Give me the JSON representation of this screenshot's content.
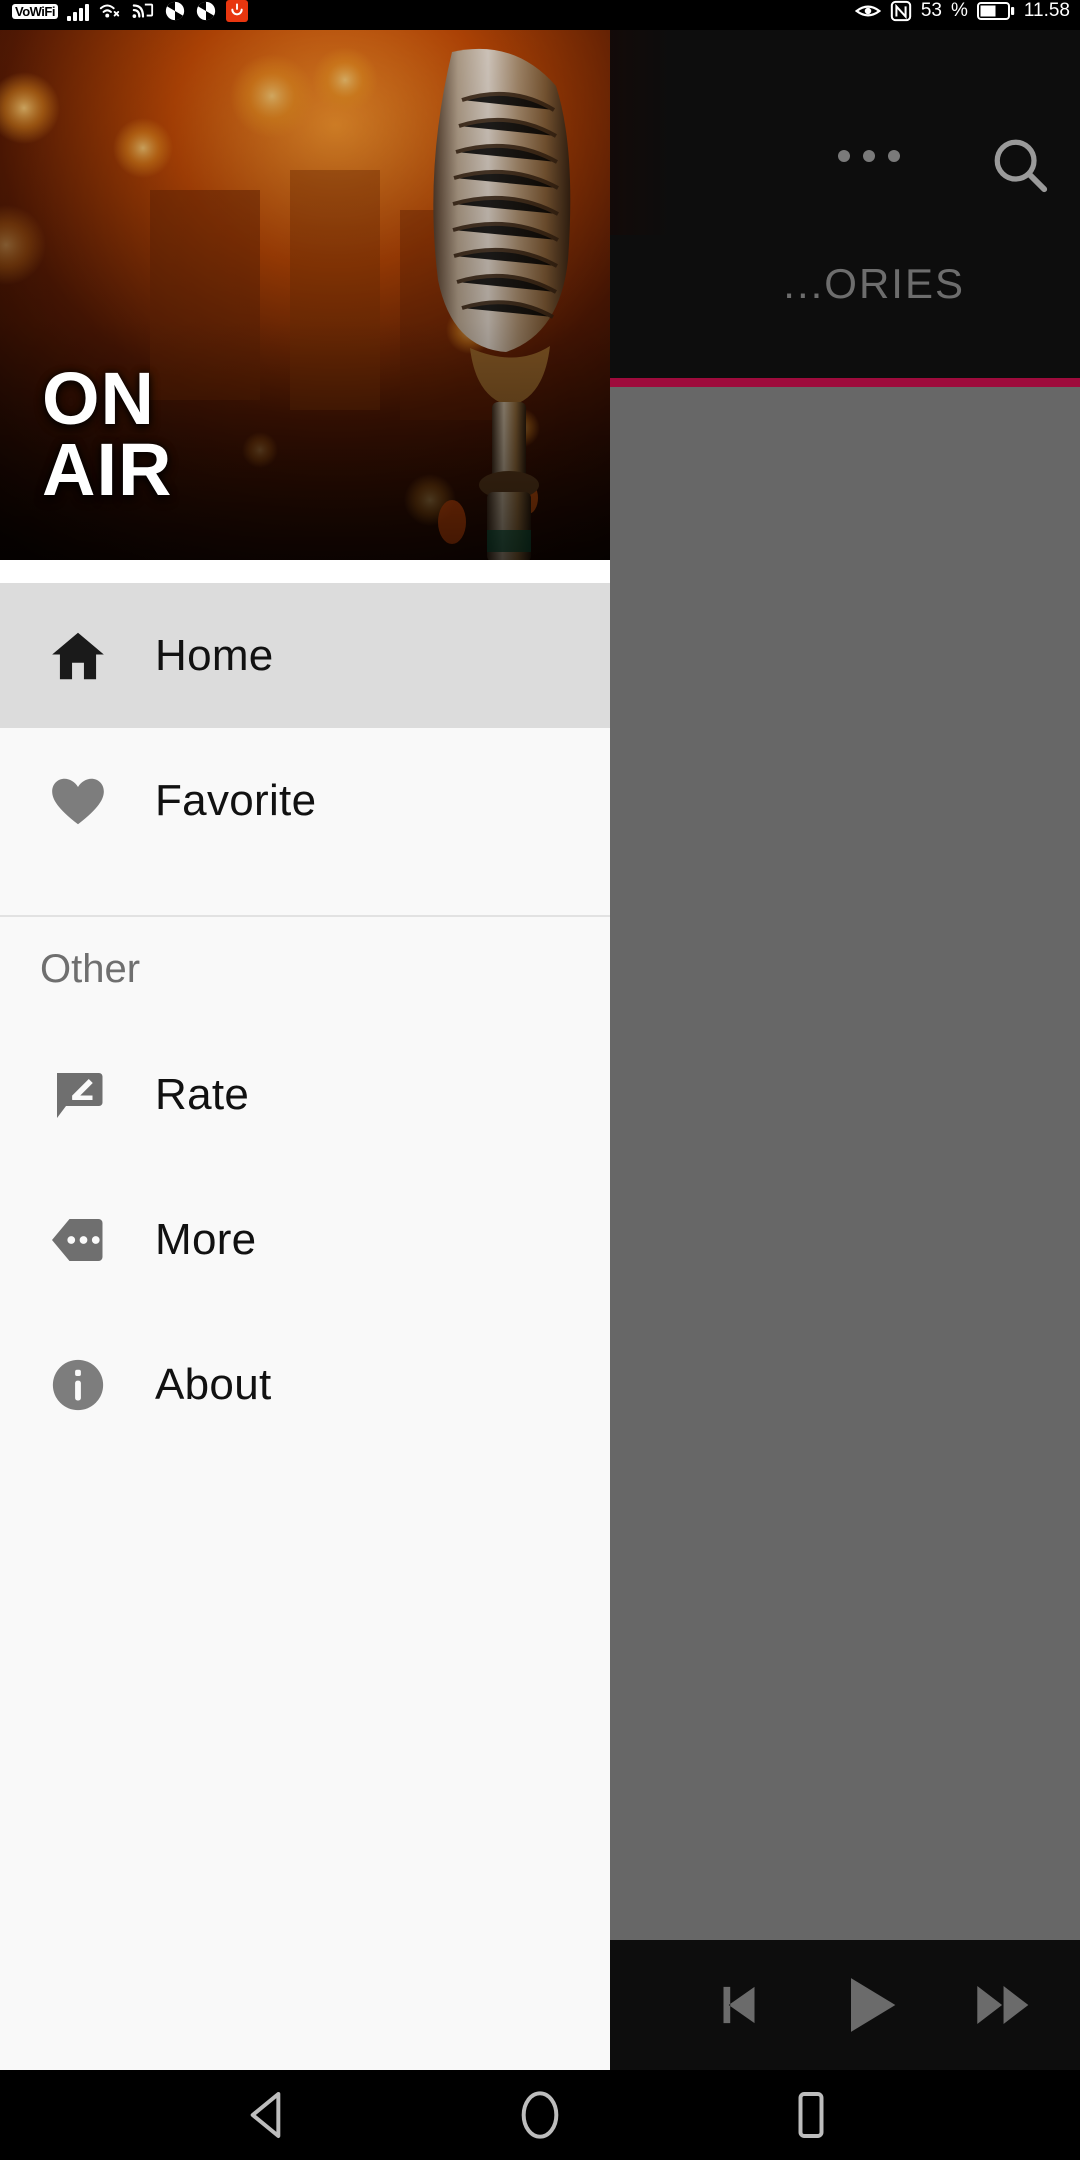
{
  "status_bar": {
    "vowifi_label": "VoWiFi",
    "icons": [
      "signal-bars-icon",
      "wifi-calling-icon",
      "cast-icon",
      "dnd-icon-1",
      "dnd-icon-2",
      "app-alert-icon"
    ],
    "right_icons": [
      "eye-icon",
      "nfc-icon"
    ],
    "battery_percent": "53",
    "percent_symbol": "%",
    "time": "11.58"
  },
  "background_app": {
    "overflow_menu": "overflow-menu",
    "search": "search-icon",
    "tab_label": "...ORIES",
    "accent_color": "#9e0b3c",
    "player": {
      "previous_label": "previous",
      "play_label": "play",
      "forward_label": "fast-forward"
    }
  },
  "drawer": {
    "header": {
      "title_line1": "ON",
      "title_line2": "AIR"
    },
    "primary_items": [
      {
        "label": "Home",
        "icon": "home-icon",
        "active": true
      },
      {
        "label": "Favorite",
        "icon": "heart-icon",
        "active": false
      }
    ],
    "section_title": "Other",
    "other_items": [
      {
        "label": "Rate",
        "icon": "rate-review-icon"
      },
      {
        "label": "More",
        "icon": "more-apps-icon"
      },
      {
        "label": "About",
        "icon": "info-icon"
      }
    ]
  },
  "nav_bar": {
    "back": "back-button",
    "home": "home-button",
    "recents": "recents-button"
  }
}
